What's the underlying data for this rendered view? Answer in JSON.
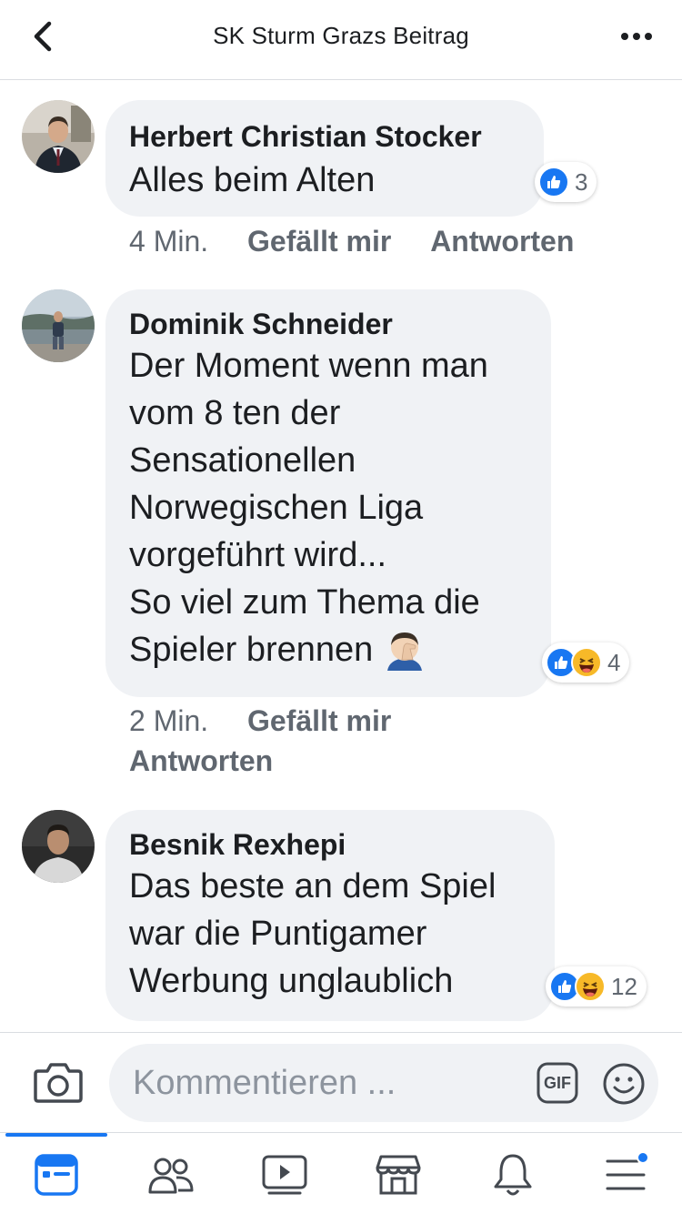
{
  "header": {
    "title": "SK Sturm Grazs Beitrag",
    "back_icon": "chevron-left-icon",
    "more_icon": "more-horizontal-icon"
  },
  "comments": [
    {
      "author": "Herbert Christian Stocker",
      "lines": [
        "Alles beim Alten"
      ],
      "reactions": [
        "like"
      ],
      "reaction_count": "3",
      "time": "4 Min.",
      "like_label": "Gefällt mir",
      "reply_label": "Antworten"
    },
    {
      "author": "Dominik Schneider",
      "lines": [
        "Der Moment wenn man",
        "vom 8 ten der",
        "Sensationellen",
        "Norwegischen Liga",
        "vorgeführt wird...",
        "So viel zum Thema die",
        "Spieler brennen"
      ],
      "trailing_emoji": "facepalm-emoji",
      "reactions": [
        "like",
        "haha"
      ],
      "reaction_count": "4",
      "time": "2 Min.",
      "like_label": "Gefällt mir",
      "reply_label": "Antworten"
    },
    {
      "author": "Besnik Rexhepi",
      "lines": [
        "Das beste an dem Spiel",
        "war die Puntigamer",
        "Werbung unglaublich"
      ],
      "reactions": [
        "like",
        "haha"
      ],
      "reaction_count": "12"
    }
  ],
  "composer": {
    "placeholder": "Kommentieren ...",
    "camera_icon": "camera-icon",
    "gif_label": "GIF",
    "emoji_icon": "smiley-icon"
  },
  "bottom_nav": {
    "items": [
      "news-feed-icon",
      "friends-icon",
      "watch-icon",
      "marketplace-icon",
      "notifications-icon",
      "menu-icon"
    ],
    "active": "news-feed-icon",
    "accent_color": "#1877f2"
  },
  "colors": {
    "bubble": "#f0f2f5",
    "meta_text": "#606770",
    "like_blue": "#1877f2",
    "haha_yellow": "#f7b928"
  }
}
